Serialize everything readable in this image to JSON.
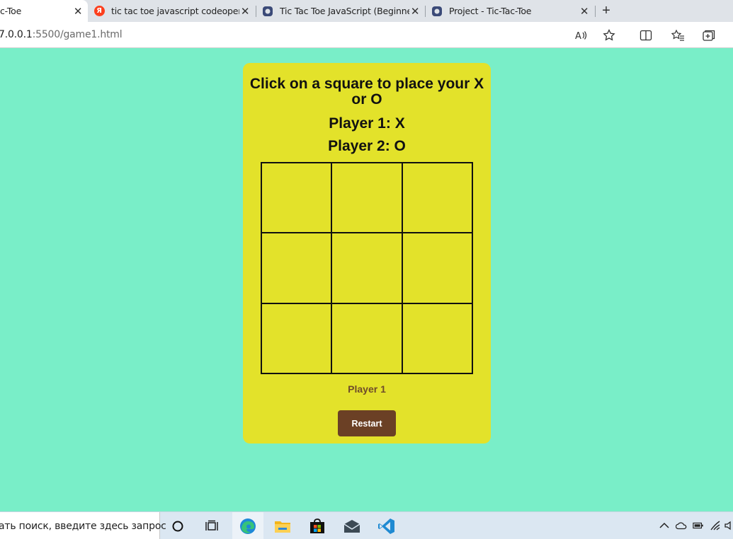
{
  "browser": {
    "tabs": [
      {
        "title": "c-Toe",
        "icon": "page-icon",
        "active": true
      },
      {
        "title": "tic tac toe javascript codeopen — ",
        "icon": "yandex-icon",
        "active": false
      },
      {
        "title": "Tic Tac Toe JavaScript (Beginner F",
        "icon": "site-icon",
        "active": false
      },
      {
        "title": "Project - Tic-Tac-Toe",
        "icon": "site-icon",
        "active": false
      }
    ],
    "new_tab_label": "+",
    "close_glyph": "✕",
    "url_host": "7.0.0.1",
    "url_rest": ":5500/game1.html",
    "toolbar_icons": [
      "read-aloud-icon",
      "favorite-star-icon",
      "split-screen-icon",
      "favorites-icon",
      "collections-icon"
    ]
  },
  "game": {
    "instructions": "Click on a square to place your X or O",
    "player1_label": "Player 1: X",
    "player2_label": "Player 2: O",
    "board": [
      "",
      "",
      "",
      "",
      "",
      "",
      "",
      "",
      ""
    ],
    "status": "Player 1",
    "restart_label": "Restart"
  },
  "taskbar": {
    "search_placeholder": "ать поиск, введите здесь запрос",
    "apps": [
      "cortana-icon",
      "task-view-icon",
      "edge-icon",
      "file-explorer-icon",
      "store-icon",
      "mail-icon",
      "vscode-icon"
    ],
    "tray": [
      "chevron-up-icon",
      "onedrive-icon",
      "battery-icon",
      "wifi-icon",
      "volume-icon"
    ]
  },
  "colors": {
    "page_background": "#79eec8",
    "card_background": "#e3e22a",
    "restart_button": "#6b4025",
    "status_text": "#6f4c2a"
  }
}
